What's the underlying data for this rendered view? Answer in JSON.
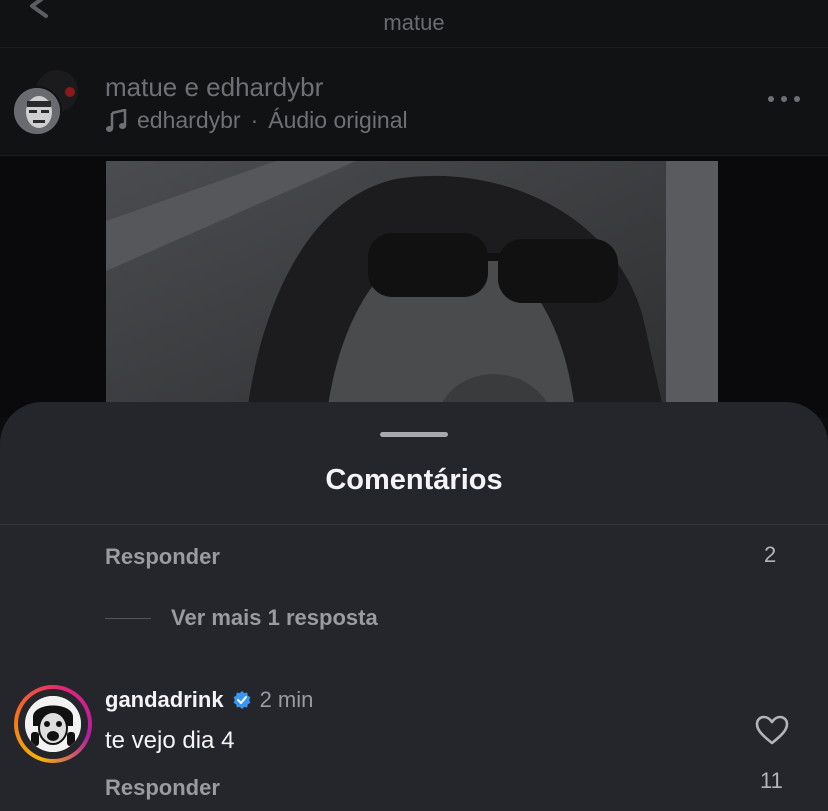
{
  "nav": {
    "title": "matue"
  },
  "post": {
    "authors": "matue e edhardybr",
    "audio_owner": "edhardybr",
    "audio_separator": "·",
    "audio_label": "Áudio original"
  },
  "comments_sheet": {
    "title": "Comentários",
    "reply_label": "Responder",
    "first_thread_count": "2",
    "view_more_replies": "Ver mais 1 resposta",
    "comment": {
      "username": "gandadrink",
      "verified": true,
      "time": "2 min",
      "text": "te vejo dia 4",
      "likes": "11",
      "reply_label": "Responder"
    }
  },
  "colors": {
    "sheet_bg": "#25262b",
    "verified_badge": "#3897f0",
    "story_ring": [
      "#f5b50a",
      "#e0247a",
      "#b21fa5"
    ]
  },
  "icons": [
    "back-chevron-icon",
    "music-note-icon",
    "more-options-icon",
    "verified-badge-icon",
    "heart-icon"
  ]
}
